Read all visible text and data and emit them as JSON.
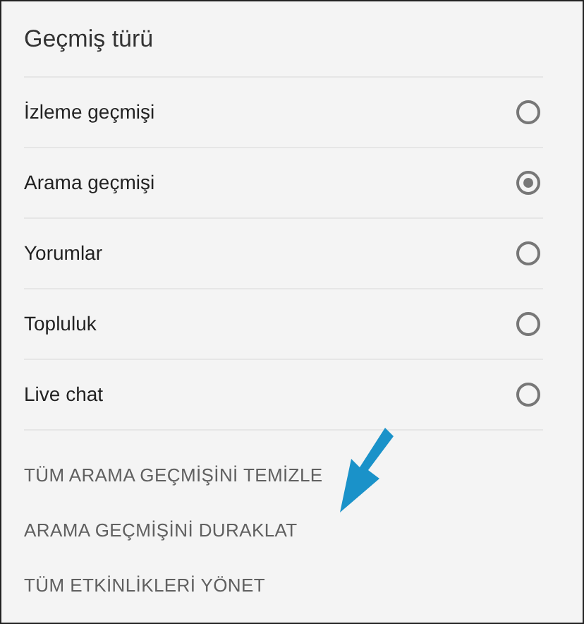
{
  "title": "Geçmiş türü",
  "options": [
    {
      "label": "İzleme geçmişi",
      "selected": false
    },
    {
      "label": "Arama geçmişi",
      "selected": true
    },
    {
      "label": "Yorumlar",
      "selected": false
    },
    {
      "label": "Topluluk",
      "selected": false
    },
    {
      "label": "Live chat",
      "selected": false
    }
  ],
  "actions": [
    "TÜM ARAMA GEÇMİŞİNİ TEMİZLE",
    "ARAMA GEÇMİŞİNİ DURAKLAT",
    "TÜM ETKİNLİKLERİ YÖNET"
  ]
}
